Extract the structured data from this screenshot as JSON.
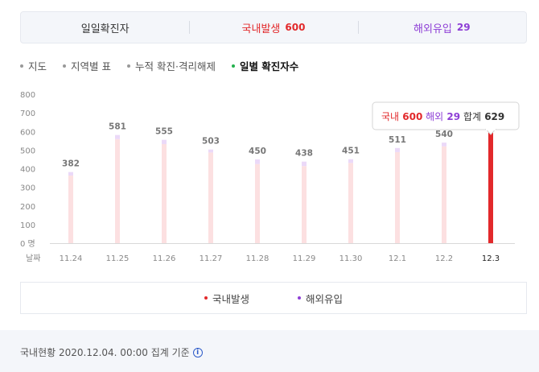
{
  "summary": {
    "title": "일일확진자",
    "domestic_label": "국내발생",
    "domestic_value": "600",
    "overseas_label": "해외유입",
    "overseas_value": "29"
  },
  "tabs": [
    "지도",
    "지역별 표",
    "누적 확진·격리해제",
    "일별 확진자수"
  ],
  "active_tab": 3,
  "chart_data": {
    "type": "bar",
    "categories": [
      "11.24",
      "11.25",
      "11.26",
      "11.27",
      "11.28",
      "11.29",
      "11.30",
      "12.1",
      "12.2",
      "12.3"
    ],
    "series": [
      {
        "name": "국내발생",
        "values": [
          363,
          559,
          532,
          487,
          425,
          414,
          431,
          489,
          520,
          600
        ]
      },
      {
        "name": "해외유입",
        "values": [
          19,
          22,
          23,
          16,
          25,
          24,
          20,
          22,
          20,
          29
        ]
      }
    ],
    "totals": [
      382,
      581,
      555,
      503,
      450,
      438,
      451,
      511,
      540,
      629
    ],
    "highlighted_index": 9,
    "y_ticks": [
      "800",
      "700",
      "600",
      "500",
      "400",
      "300",
      "200",
      "100",
      "0 명"
    ],
    "x_label": "날짜",
    "ylim": [
      0,
      800
    ],
    "colors": {
      "domestic": "#fce0e1",
      "overseas": "#ebd9f8",
      "highlight": "#e2292b"
    },
    "tooltip": {
      "domestic_label": "국내",
      "domestic_value": "600",
      "overseas_label": "해외",
      "overseas_value": "29",
      "total_label": "합계",
      "total_value": "629"
    }
  },
  "legend": {
    "domestic": "국내발생",
    "overseas": "해외유입"
  },
  "footer": {
    "text": "국내현황 2020.12.04. 00:00 집계 기준",
    "icon": "info-icon"
  }
}
